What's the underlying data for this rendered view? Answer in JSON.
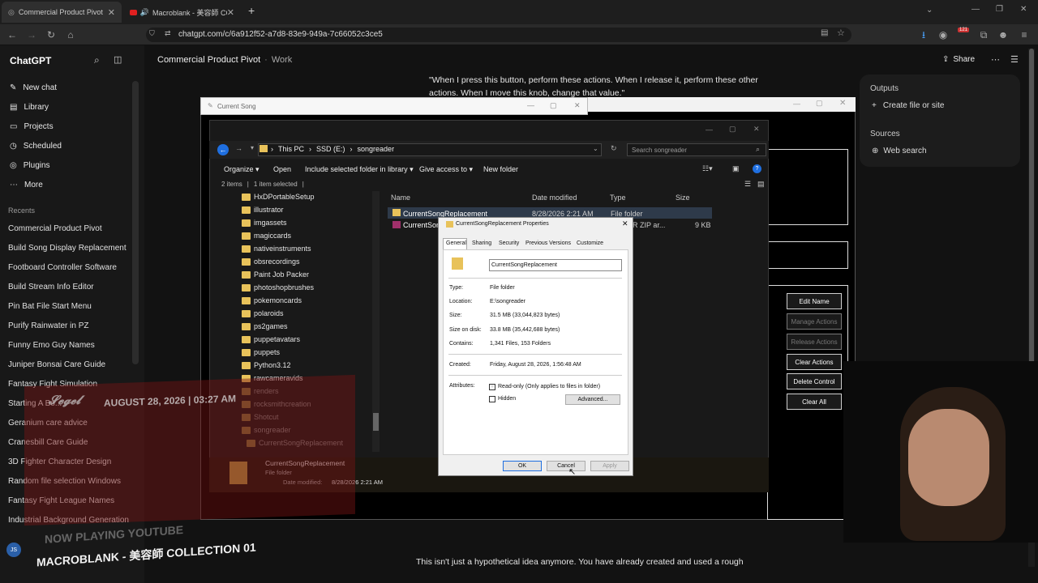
{
  "browser": {
    "tabs": [
      {
        "label": "Commercial Product Pivot",
        "close": "✕"
      },
      {
        "label": "Macroblank - 美容師 COLL"
      }
    ],
    "new_tab": "+",
    "url": "chatgpt.com/c/6a912f52-a7d8-83e9-949a-7c66052c3ce5",
    "badge": "121"
  },
  "chatgpt": {
    "brand": "ChatGPT",
    "nav": [
      {
        "label": "New chat",
        "icon": "✎"
      },
      {
        "label": "Library",
        "icon": "▤"
      },
      {
        "label": "Projects",
        "icon": "▭"
      },
      {
        "label": "Scheduled",
        "icon": "◷"
      },
      {
        "label": "Plugins",
        "icon": "◎"
      },
      {
        "label": "More",
        "icon": "⋯"
      }
    ],
    "recents_title": "Recents",
    "recents": [
      "Commercial Product Pivot",
      "Build Song Display Replacement",
      "Footboard Controller Software",
      "Build Stream Info Editor",
      "Pin Bat File Start Menu",
      "Purify Rainwater in PZ",
      "Funny Emo Guy Names",
      "Juniper Bonsai Care Guide",
      "Fantasy Fight Simulation",
      "Starting A Bo...",
      "Geranium care advice",
      "Cranesbill Care Guide",
      "3D Fighter Character Design",
      "Random file selection Windows",
      "Fantasy Fight League Names",
      "Industrial Background Generation"
    ],
    "avatar": "JS",
    "header_title": "Commercial Product Pivot",
    "header_sep": "·",
    "header_project": "Work",
    "share": "Share",
    "message_text": "\"When I press this button, perform these actions. When I release it, perform these other actions. When I move this knob, change that value.\"",
    "bottom_text": "This isn't just a hypothetical idea anymore. You have already created and used a rough",
    "outputs_title": "Outputs",
    "create_file": "Create file or site",
    "sources_title": "Sources",
    "web_search": "Web search"
  },
  "current_song_window": {
    "title": "Current Song"
  },
  "explorer": {
    "path": [
      "This PC",
      "SSD (E:)",
      "songreader"
    ],
    "search_placeholder": "Search songreader",
    "toolbar": [
      "Organize ▾",
      "Open",
      "Include selected folder in library ▾",
      "Give access to ▾",
      "New folder"
    ],
    "status": [
      "2 items",
      "1 item selected"
    ],
    "tree": [
      "HxDPortableSetup",
      "illustrator",
      "imgassets",
      "magiccards",
      "nativeinstruments",
      "obsrecordings",
      "Paint Job Packer",
      "photoshopbrushes",
      "pokemoncards",
      "polaroids",
      "ps2games",
      "puppetavatars",
      "puppets",
      "Python3.12",
      "rawcameravids",
      "renders",
      "rocksmithcreation",
      "Shotcut",
      "songreader",
      "CurrentSongReplacement"
    ],
    "columns": [
      "Name",
      "Date modified",
      "Type",
      "Size"
    ],
    "rows": [
      {
        "name": "CurrentSongReplacement",
        "date": "8/28/2026 2:21 AM",
        "type": "File folder",
        "size": ""
      },
      {
        "name": "CurrentSon",
        "date": "",
        "type": "R ZIP ar...",
        "size": "9 KB"
      }
    ],
    "details": {
      "name": "CurrentSongReplacement",
      "type": "File folder",
      "date_label": "Date modified:",
      "date": "8/28/2026 2:21 AM"
    }
  },
  "app_buttons": [
    "Edit Name",
    "Manage Actions",
    "Release Actions",
    "Clear Actions",
    "Delete Control",
    "Clear All"
  ],
  "properties": {
    "title": "CurrentSongReplacement Properties",
    "tabs": [
      "General",
      "Sharing",
      "Security",
      "Previous Versions",
      "Customize"
    ],
    "name_value": "CurrentSongReplacement",
    "fields": [
      {
        "label": "Type:",
        "value": "File folder"
      },
      {
        "label": "Location:",
        "value": "E:\\songreader"
      },
      {
        "label": "Size:",
        "value": "31.5 MB (33,044,823 bytes)"
      },
      {
        "label": "Size on disk:",
        "value": "33.8 MB (35,442,688 bytes)"
      },
      {
        "label": "Contains:",
        "value": "1,341 Files, 153 Folders"
      },
      {
        "label": "Created:",
        "value": "Friday, August 28, 2026, 1:56:48 AM"
      }
    ],
    "attributes_label": "Attributes:",
    "readonly": "Read-only (Only applies to files in folder)",
    "hidden": "Hidden",
    "advanced": "Advanced...",
    "ok": "OK",
    "cancel": "Cancel",
    "apply": "Apply"
  },
  "overlay": {
    "date": "AUGUST 28, 2026 | 03:27 AM",
    "now_playing": "NOW PLAYING YOUTUBE",
    "track": "MACROBLANK - 美容師 COLLECTION 01"
  },
  "colors": {
    "accent_blue": "#1f6fe0",
    "folder_yellow": "#e8c25a",
    "overlay_red": "#8b1a1a"
  }
}
